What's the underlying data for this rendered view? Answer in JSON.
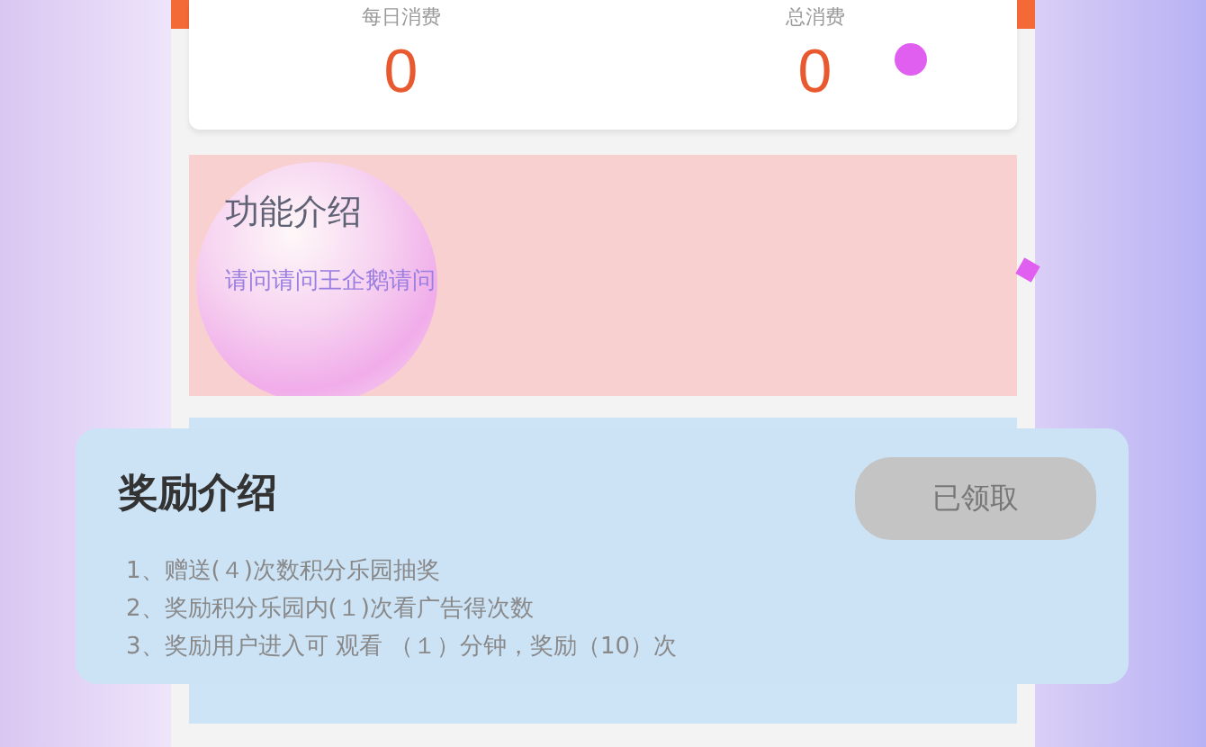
{
  "stats": [
    {
      "label": "每日消费",
      "value": "0"
    },
    {
      "label": "总消费",
      "value": "0"
    }
  ],
  "feature_card": {
    "title": "功能介绍",
    "text": "请问请问王企鹅请问"
  },
  "reward_card": {
    "title": "奖励介绍",
    "button": {
      "label": "已领取",
      "disabled": true
    },
    "lines": [
      "1、赠送(４)次数积分乐园抽奖",
      "2、奖励积分乐园内(１)次看广告得次数",
      "3、奖励用户进入可 观看 （１）分钟，奖励（10）次"
    ]
  }
}
